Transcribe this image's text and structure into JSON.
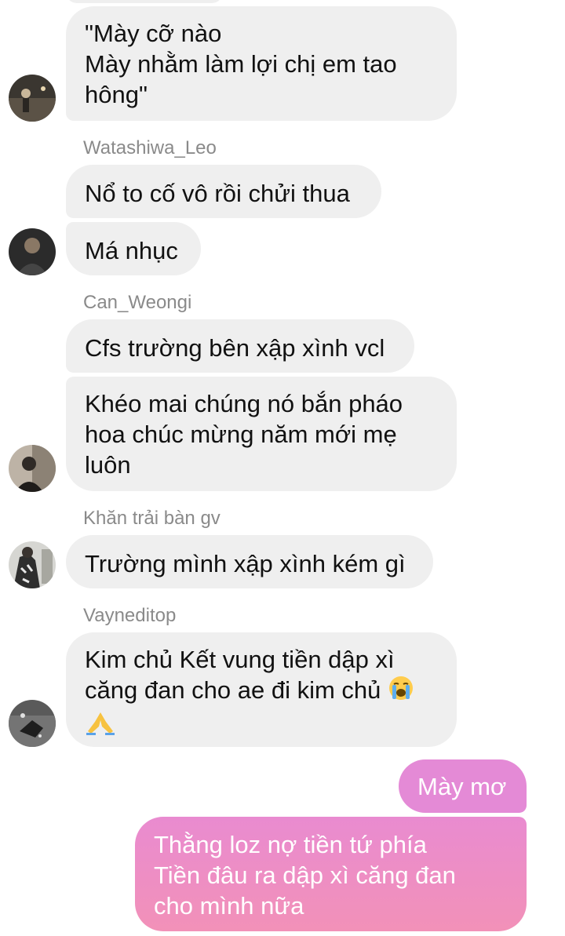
{
  "messages": [
    {
      "lines": [
        "\"Mày cỡ nào",
        "Mày nhằm làm lợi chị em tao",
        "hông\""
      ]
    },
    {
      "sender": "Watashiwa_Leo",
      "bubbles": [
        {
          "text": "Nổ to cố vô rồi chửi thua"
        },
        {
          "text": "Má nhục"
        }
      ]
    },
    {
      "sender": "Can_Weongi",
      "bubbles": [
        {
          "text": "Cfs trường bên xập xình vcl"
        },
        {
          "lines": [
            "Khéo mai chúng nó bắn pháo",
            "hoa chúc mừng năm mới mẹ",
            "luôn"
          ]
        }
      ]
    },
    {
      "sender": "Khăn trải bàn gv",
      "bubbles": [
        {
          "text": "Trường mình xập xình kém gì"
        }
      ]
    },
    {
      "sender": "Vayneditop",
      "bubbles": [
        {
          "lines": [
            "Kim chủ Kết vung tiền dập xì",
            "căng đan cho ae đi kim chủ",
            ""
          ],
          "emojis": [
            "loudly-crying-face",
            "folded-hands"
          ]
        }
      ]
    }
  ],
  "outgoing": [
    {
      "text": "Mày mơ"
    },
    {
      "lines": [
        "Thằng loz nợ tiền tứ phía",
        "Tiền đâu ra dập xì căng đan",
        "cho mình nữa"
      ]
    }
  ],
  "colors": {
    "incoming_bubble": "#efefef",
    "outgoing_top": "#e48ad6",
    "outgoing_bottom": "#f291b8",
    "sender_name": "#8a8a8a"
  }
}
